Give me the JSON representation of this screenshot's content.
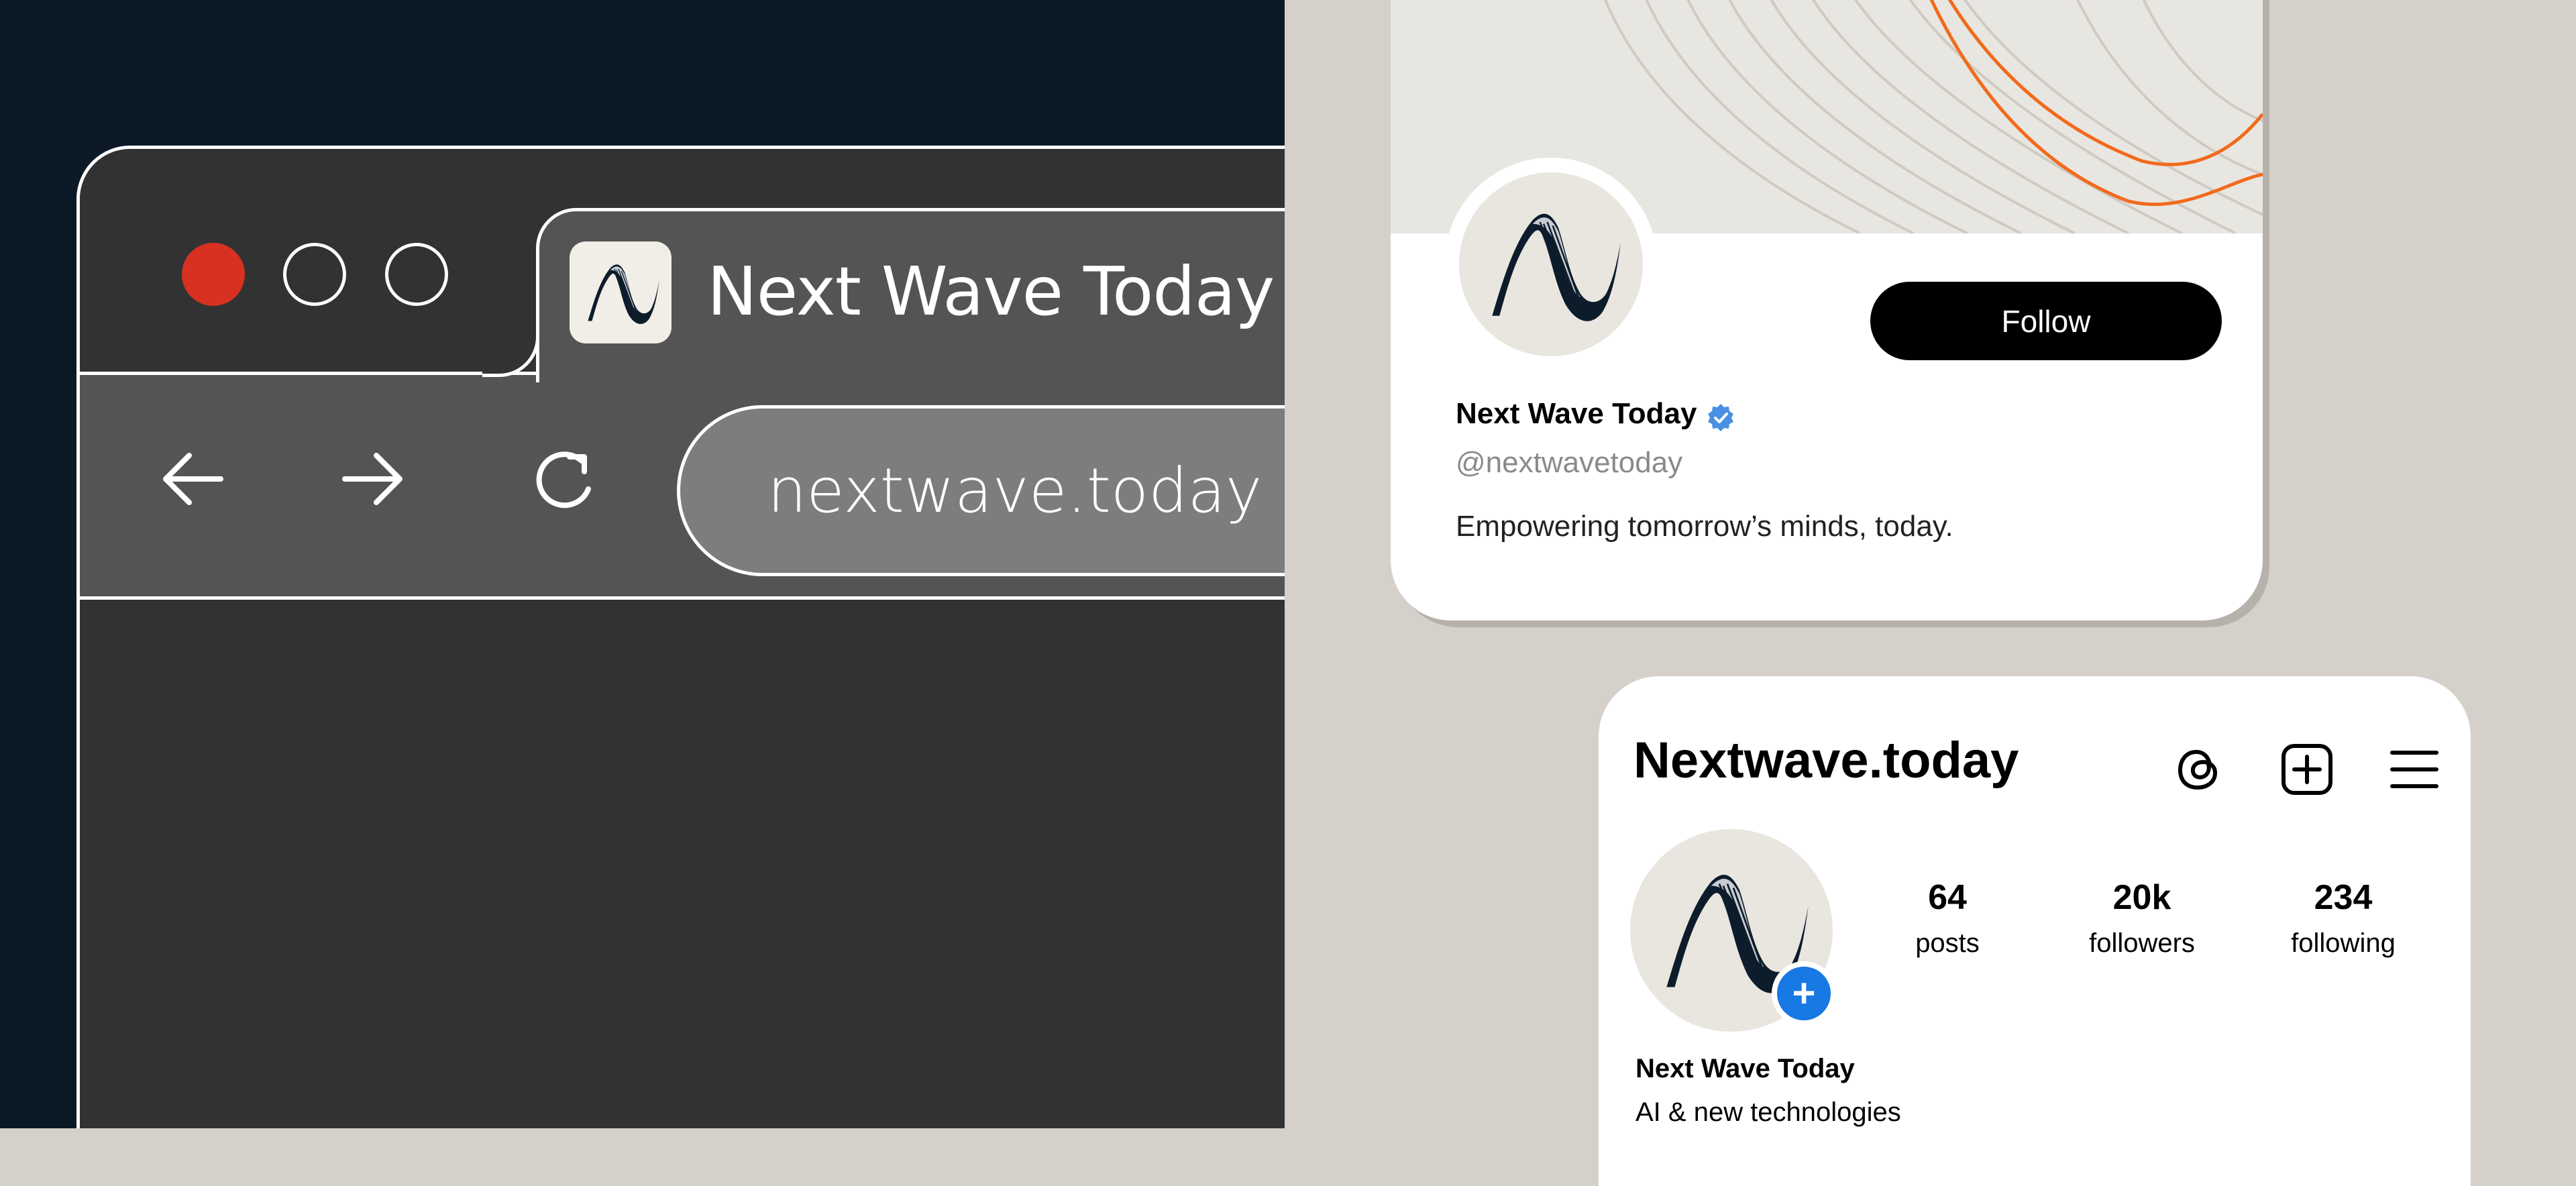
{
  "browser": {
    "tab_title": "Next Wave Today",
    "url": "nextwave.today",
    "window_controls": [
      "close",
      "minimize",
      "maximize"
    ],
    "nav_icons": [
      "arrow-left-icon",
      "arrow-right-icon",
      "reload-icon"
    ],
    "colors": {
      "close": "#d83121",
      "chrome_dark": "#323232",
      "chrome_mid": "#545454",
      "url_bg": "#7d7d7d"
    }
  },
  "x_profile": {
    "name": "Next Wave Today",
    "handle": "@nextwavetoday",
    "bio": "Empowering tomorrow’s minds, today.",
    "follow_label": "Follow",
    "verified": true,
    "colors": {
      "banner_line": "#f26a1b",
      "verified": "#4a90e2"
    }
  },
  "ig_profile": {
    "username": "Nextwave.today",
    "stats": [
      {
        "value": "64",
        "label": "posts"
      },
      {
        "value": "20k",
        "label": "followers"
      },
      {
        "value": "234",
        "label": "following"
      }
    ],
    "name": "Next Wave Today",
    "bio": "AI & new technologies",
    "icons": [
      "threads-icon",
      "add-post-icon",
      "menu-icon"
    ],
    "add_story_symbol": "+",
    "colors": {
      "plus": "#1878e4"
    }
  },
  "background": {
    "left": "#0b1927",
    "right": "#d5d0c9"
  }
}
